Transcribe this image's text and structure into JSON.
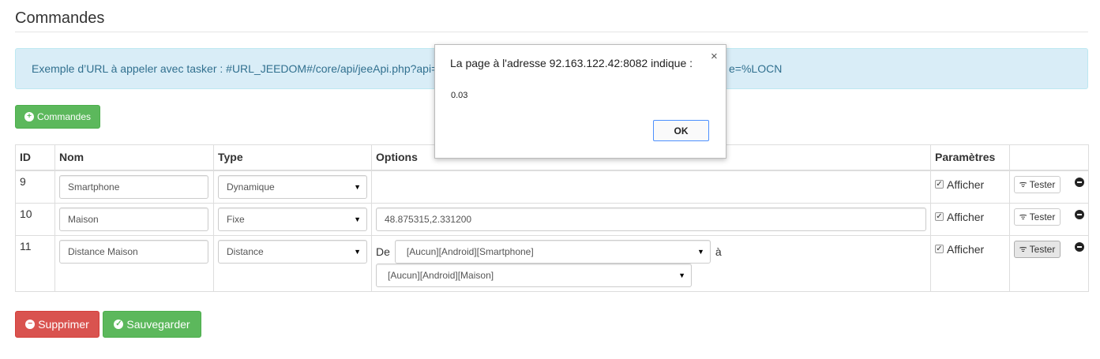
{
  "page": {
    "title": "Commandes"
  },
  "info": {
    "text_left": "Exemple d’URL à appeler avec tasker : #URL_JEEDOM#/core/api/jeeApi.php?api=",
    "text_right": "e=%LOCN"
  },
  "buttons": {
    "add": "Commandes",
    "delete": "Supprimer",
    "save": "Sauvegarder"
  },
  "table": {
    "headers": [
      "ID",
      "Nom",
      "Type",
      "Options",
      "Paramètres",
      ""
    ],
    "rows": [
      {
        "id": "9",
        "name": "Smartphone",
        "type": "Dynamique",
        "options": "",
        "afficher": "Afficher",
        "test": "Tester"
      },
      {
        "id": "10",
        "name": "Maison",
        "type": "Fixe",
        "options": "48.875315,2.331200",
        "afficher": "Afficher",
        "test": "Tester"
      },
      {
        "id": "11",
        "name": "Distance Maison",
        "type": "Distance",
        "from_label": "De",
        "from": "[Aucun][Android][Smartphone]",
        "to_label": "à",
        "to": "[Aucun][Android][Maison]",
        "afficher": "Afficher",
        "test": "Tester"
      }
    ]
  },
  "dialog": {
    "message": "La page à l'adresse 92.163.122.42:8082 indique :",
    "value": "0.03",
    "ok": "OK",
    "close": "×"
  },
  "icons": {
    "caret": "▼",
    "check": "✓",
    "rss": "rss-icon",
    "remove": "minus-circle-icon"
  },
  "colors": {
    "success": "#5cb85c",
    "danger": "#d9534f",
    "info_bg": "#d9edf7",
    "info_text": "#31708f"
  }
}
